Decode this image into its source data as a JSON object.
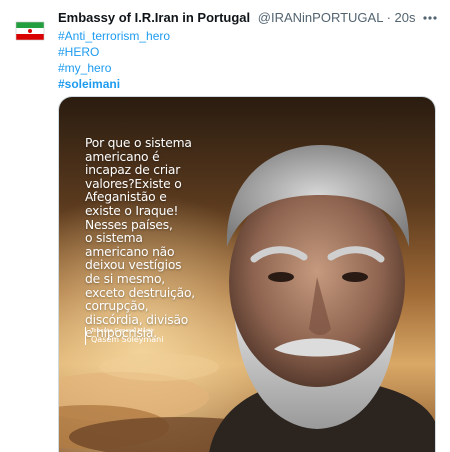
{
  "tweet": {
    "display_name": "Embassy of I.R.Iran in Portugal",
    "handle": "@IRANinPORTUGAL",
    "separator": "·",
    "time": "20s",
    "hashtags": [
      "#Anti_terrorism_hero",
      "#HERO",
      "#my_hero",
      "#soleimani"
    ],
    "more_icon": "more-horizontal-icon",
    "avatar_icon": "iran-flag-icon"
  },
  "media": {
    "quote": "Por que o sistema\namericano é\nincapaz de criar\nvalores?Existe o\nAfeganistão e\nexiste o Iraque!\nNesses países,\no sistema\namericano não\ndeixou vestígios\nde si mesmo,\nexceto destruição,\ncorrupção,\ndiscórdia, divisão\ne hipocrisia.",
    "attribution_title": "Tenente General Mártir",
    "attribution_name": "Qasem Soleymani"
  },
  "colors": {
    "link": "#1d9bf0",
    "secondary_text": "#536471",
    "primary_text": "#0f1419"
  }
}
